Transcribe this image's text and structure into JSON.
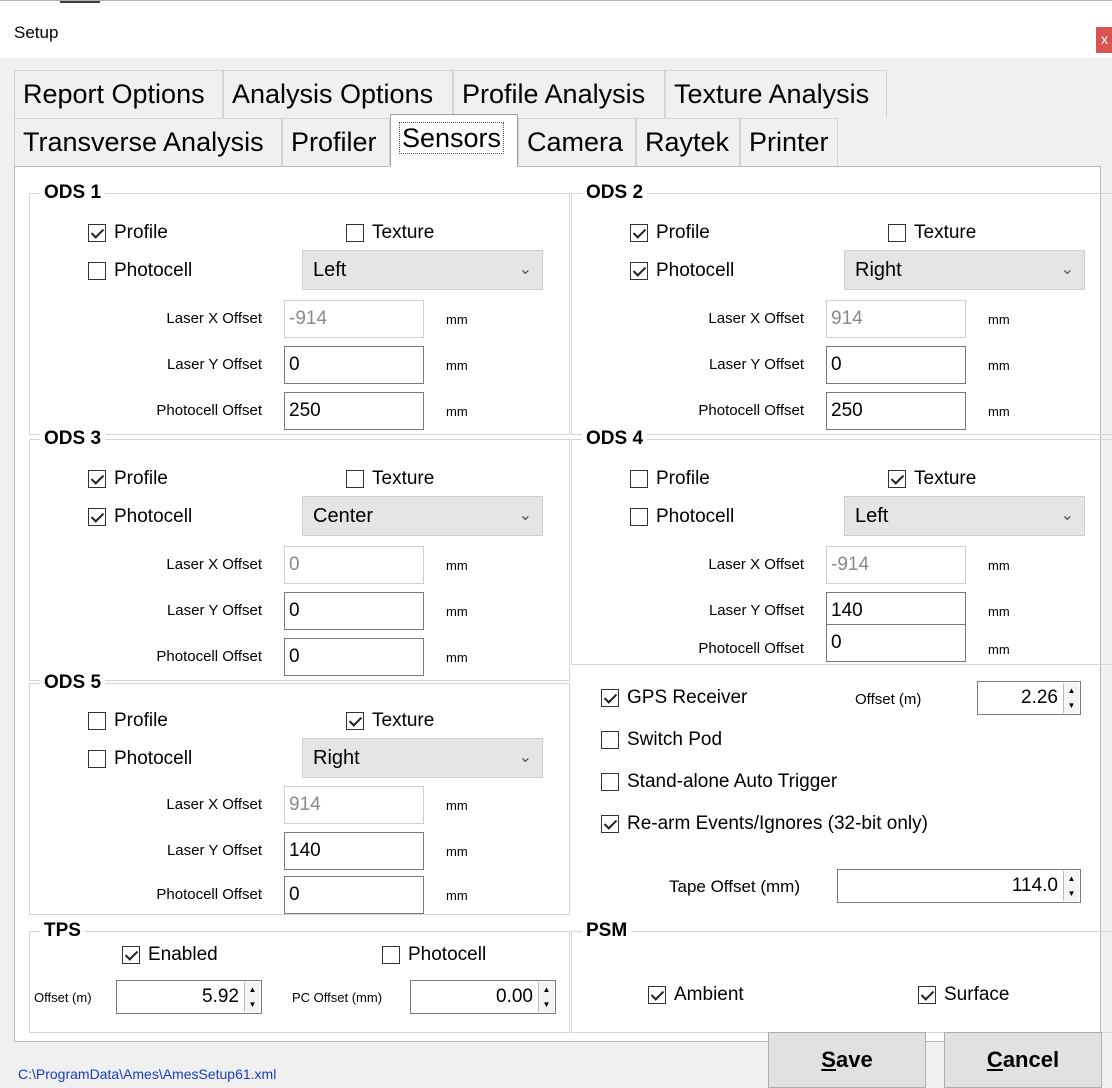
{
  "window": {
    "title": "Setup",
    "close_glyph": "x"
  },
  "tabs_row1": [
    "Report Options",
    "Analysis Options",
    "Profile Analysis",
    "Texture Analysis"
  ],
  "tabs_row2": [
    "Transverse Analysis",
    "Profiler",
    "Sensors",
    "Camera",
    "Raytek",
    "Printer"
  ],
  "active_tab": "Sensors",
  "ods_labels": {
    "profile": "Profile",
    "texture": "Texture",
    "photocell": "Photocell",
    "laser_x": "Laser X Offset",
    "laser_y": "Laser Y Offset",
    "photocell_offset": "Photocell Offset",
    "unit": "mm"
  },
  "ods": [
    {
      "title": "ODS 1",
      "profile": true,
      "texture": false,
      "photocell": false,
      "position": "Left",
      "laser_x": "-914",
      "laser_y": "0",
      "photocell_offset": "250"
    },
    {
      "title": "ODS 2",
      "profile": true,
      "texture": false,
      "photocell": true,
      "position": "Right",
      "laser_x": "914",
      "laser_y": "0",
      "photocell_offset": "250"
    },
    {
      "title": "ODS 3",
      "profile": true,
      "texture": false,
      "photocell": true,
      "position": "Center",
      "laser_x": "0",
      "laser_y": "0",
      "photocell_offset": "0"
    },
    {
      "title": "ODS 4",
      "profile": false,
      "texture": true,
      "photocell": false,
      "position": "Left",
      "laser_x": "-914",
      "laser_y": "140",
      "photocell_offset": "0"
    },
    {
      "title": "ODS 5",
      "profile": false,
      "texture": true,
      "photocell": false,
      "position": "Right",
      "laser_x": "914",
      "laser_y": "140",
      "photocell_offset": "0"
    }
  ],
  "options": {
    "gps_receiver": {
      "label": "GPS Receiver",
      "checked": true
    },
    "gps_offset_label": "Offset (m)",
    "gps_offset": "2.26",
    "switch_pod": {
      "label": "Switch Pod",
      "checked": false
    },
    "auto_trigger": {
      "label": "Stand-alone Auto Trigger",
      "checked": false
    },
    "rearm_events": {
      "label": "Re-arm Events/Ignores (32-bit only)",
      "checked": true
    },
    "tape_offset_label": "Tape Offset (mm)",
    "tape_offset": "114.0"
  },
  "tps": {
    "title": "TPS",
    "enabled": {
      "label": "Enabled",
      "checked": true
    },
    "photocell": {
      "label": "Photocell",
      "checked": false
    },
    "offset_label": "Offset (m)",
    "offset": "5.92",
    "pc_offset_label": "PC Offset (mm)",
    "pc_offset": "0.00"
  },
  "psm": {
    "title": "PSM",
    "ambient": {
      "label": "Ambient",
      "checked": true
    },
    "surface": {
      "label": "Surface",
      "checked": true
    }
  },
  "footer": {
    "file_path": "C:\\ProgramData\\Ames\\AmesSetup61.xml",
    "save_mnemonic": "S",
    "save_rest": "ave",
    "cancel_mnemonic": "C",
    "cancel_rest": "ancel"
  },
  "icons": {
    "checkbox": "checkbox-icon",
    "chevron": "chevron-down-icon",
    "spinner": "spinner-arrows-icon",
    "close": "close-icon"
  }
}
